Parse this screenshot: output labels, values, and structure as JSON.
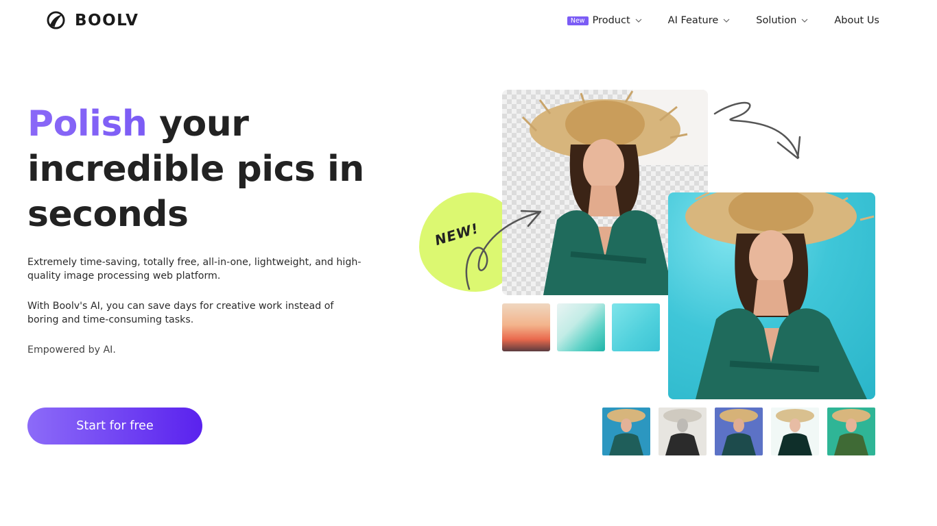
{
  "header": {
    "logo_text": "BOOLV",
    "logo_icon": "boolv-logo-icon",
    "nav": [
      {
        "label": "Product",
        "badge": "New",
        "has_dropdown": true
      },
      {
        "label": "AI Feature",
        "has_dropdown": true
      },
      {
        "label": "Solution",
        "has_dropdown": true
      },
      {
        "label": "About Us",
        "has_dropdown": false
      }
    ]
  },
  "hero": {
    "headline_accent": "Polish",
    "headline_rest_1": " your",
    "headline_rest_2": "incredible pics in",
    "headline_rest_3": "seconds",
    "paragraph_1": "Extremely time-saving, totally free, all-in-one, lightweight, and high-quality image processing web platform.",
    "paragraph_2": "With Boolv's AI, you can save days for creative work instead of boring and time-consuming tasks.",
    "paragraph_3": "Empowered by AI.",
    "cta_label": "Start for free"
  },
  "visual": {
    "new_sticker": "NEW!",
    "accent_color": "#7b5cf5",
    "sticker_color": "#dcf871",
    "background_swatches": [
      "sunset-gradient",
      "teal-wave",
      "aqua-watercolor"
    ],
    "style_thumbnails": [
      "blue-style",
      "sketch-style",
      "indigo-style",
      "ink-style",
      "green-style"
    ]
  }
}
